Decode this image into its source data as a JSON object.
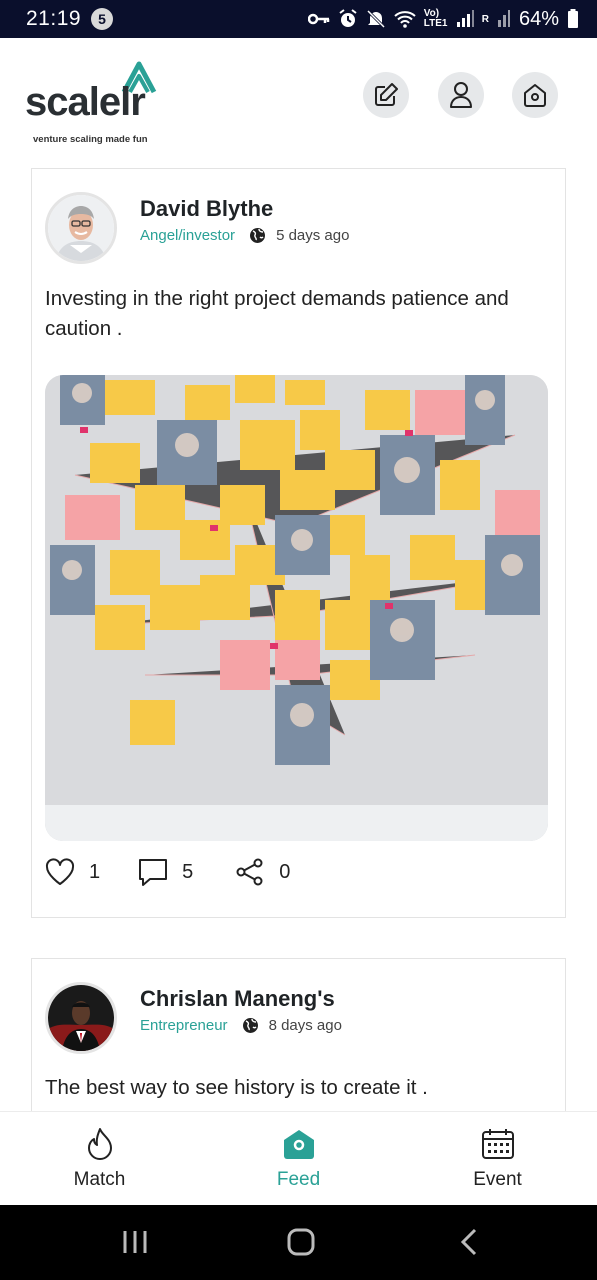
{
  "status_bar": {
    "time": "21:19",
    "notification_count": "5",
    "network": "Vo) LTE1",
    "sim2": "R",
    "battery": "64%"
  },
  "header": {
    "logo_text": "scalelr",
    "tagline": "venture scaling made fun",
    "icons": [
      "edit-icon",
      "profile-icon",
      "home-icon"
    ]
  },
  "posts": [
    {
      "author": "David Blythe",
      "role": "Angel/investor",
      "time_ago": "5 days ago",
      "text": "Investing in the right project demands patience and caution .",
      "likes": "1",
      "comments": "5",
      "shares": "0"
    },
    {
      "author": "Chrislan Maneng's",
      "role": "Entrepreneur",
      "time_ago": "8 days ago",
      "text": "The best way to see history is to create it ."
    }
  ],
  "bottom_nav": {
    "items": [
      {
        "label": "Match",
        "icon": "flame-icon"
      },
      {
        "label": "Feed",
        "icon": "home-feed-icon"
      },
      {
        "label": "Event",
        "icon": "calendar-icon"
      }
    ],
    "active": "Feed"
  },
  "colors": {
    "accent": "#2aa196",
    "status_bar": "#0a0f2c",
    "nav_bar": "#000000"
  }
}
